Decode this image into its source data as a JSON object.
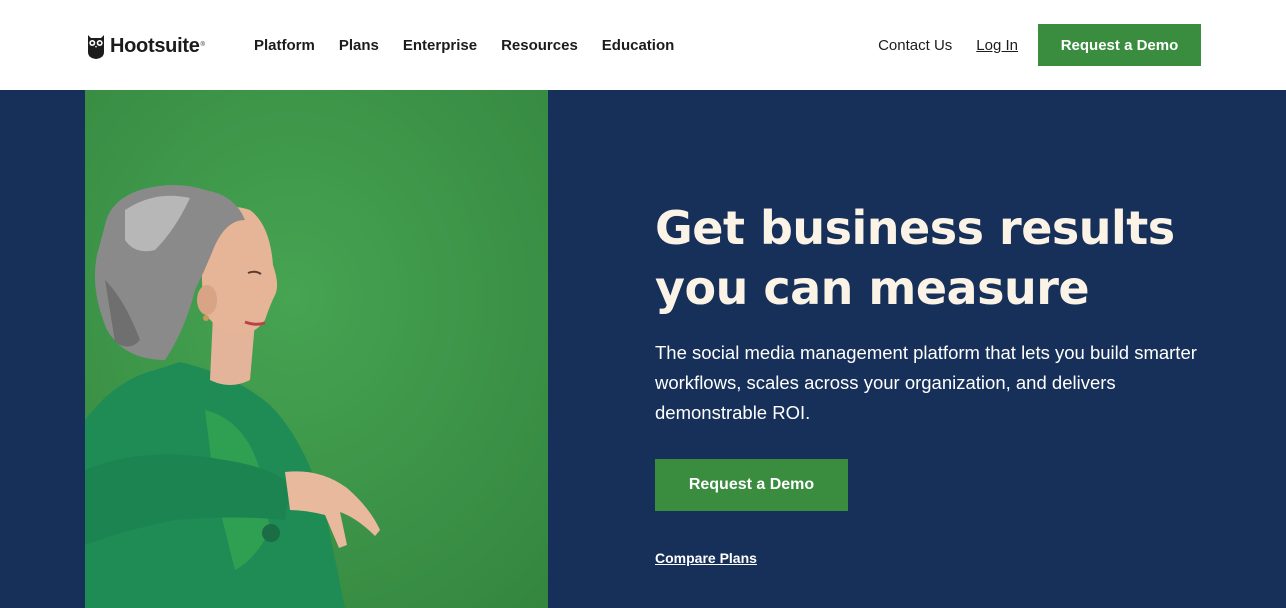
{
  "header": {
    "logo_text": "Hootsuite",
    "logo_reg": "®",
    "nav": [
      "Platform",
      "Plans",
      "Enterprise",
      "Resources",
      "Education"
    ],
    "contact_label": "Contact Us",
    "login_label": "Log In",
    "demo_label": "Request a Demo"
  },
  "hero": {
    "title": "Get business results you can measure",
    "subtitle": "The social media management platform that lets you build smarter workflows, scales across your organization, and delivers demonstrable ROI.",
    "demo_label": "Request a Demo",
    "compare_label": "Compare Plans"
  },
  "colors": {
    "brand_green": "#3a8c3f",
    "hero_navy": "#16305a",
    "hero_title": "#fbf3e6",
    "photo_bg": "#3c9447"
  }
}
